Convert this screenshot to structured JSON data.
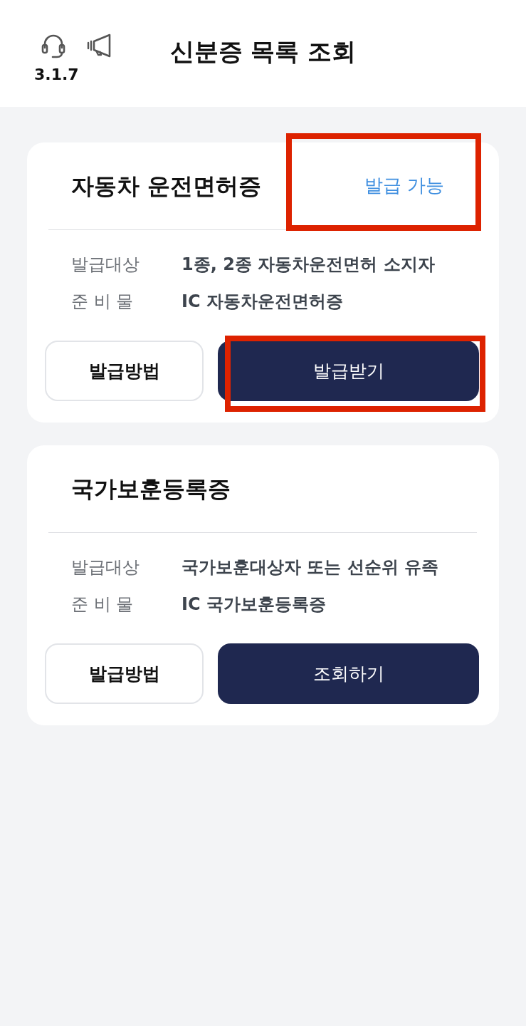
{
  "header": {
    "version": "3.1.7",
    "title": "신분증 목록 조회"
  },
  "cards": [
    {
      "title": "자동차 운전면허증",
      "status": {
        "text": "발급 가능",
        "highlighted": true
      },
      "details": [
        {
          "label": "발급대상",
          "value": "1종, 2종 자동차운전면허 소지자"
        },
        {
          "label": "준 비 물",
          "value": "IC 자동차운전면허증"
        }
      ],
      "buttons": [
        {
          "label": "발급방법",
          "kind": "outline",
          "highlighted": false
        },
        {
          "label": "발급받기",
          "kind": "filled",
          "highlighted": true
        }
      ]
    },
    {
      "title": "국가보훈등록증",
      "details": [
        {
          "label": "발급대상",
          "value": "국가보훈대상자 또는 선순위 유족"
        },
        {
          "label": "준 비 물",
          "value": "IC 국가보훈등록증"
        }
      ],
      "buttons": [
        {
          "label": "발급방법",
          "kind": "outline",
          "highlighted": false
        },
        {
          "label": "조회하기",
          "kind": "filled",
          "highlighted": false
        }
      ]
    }
  ]
}
